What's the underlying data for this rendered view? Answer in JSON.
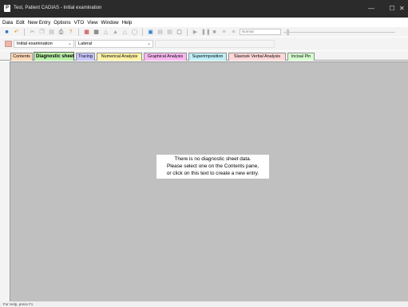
{
  "window": {
    "title": "Test, Patient CADIAS - Initial examination",
    "app_icon": "app-logo-icon",
    "controls": {
      "minimize": "—",
      "maximize": "☐",
      "close": "✕"
    }
  },
  "menu": [
    "Data",
    "Edit",
    "New Entry",
    "Options",
    "VTO",
    "View",
    "Window",
    "Help"
  ],
  "toolbar": {
    "combo_value": "Normal",
    "icons": [
      "save-icon",
      "undo-icon",
      "cut-icon",
      "copy-icon",
      "paste-icon",
      "print-icon",
      "help-icon",
      "tool-icon",
      "tool-icon",
      "tool-icon",
      "tool-icon",
      "tool-icon",
      "tool-icon",
      "view-icon",
      "view-icon",
      "view-icon",
      "view-icon",
      "play-icon",
      "pause-icon",
      "stop-icon",
      "rewind-icon",
      "step-icon"
    ]
  },
  "selectors": {
    "examination": "Initial examination",
    "view": "Lateral",
    "swatch_color": "#f2b4a8"
  },
  "tabs": [
    {
      "label": "Contents",
      "color": "#ffd9b8",
      "active": false
    },
    {
      "label": "Diagnostic sheet",
      "color": "#b9f0a8",
      "active": true
    },
    {
      "label": "Tracing",
      "color": "#c6c6ff",
      "active": false
    },
    {
      "label": "Numerical Analysis",
      "color": "#fff3a6",
      "active": false
    },
    {
      "label": "Graphical Analysis",
      "color": "#f8b8f0",
      "active": false
    },
    {
      "label": "Superimposition",
      "color": "#bfeff8",
      "active": false
    },
    {
      "label": "Slavicek Verbal Analysis",
      "color": "#ffd8d8",
      "active": false
    },
    {
      "label": "Incisal Pin",
      "color": "#d8ffd0",
      "active": false
    }
  ],
  "content": {
    "message_line1": "There is no diagnostic sheet data.",
    "message_line2": "Please select one on the Contents pane,",
    "message_line3": "or click on this text to create a new entry.",
    "background": "#c0c0c0"
  },
  "status": {
    "text": "For Help, press F1"
  }
}
